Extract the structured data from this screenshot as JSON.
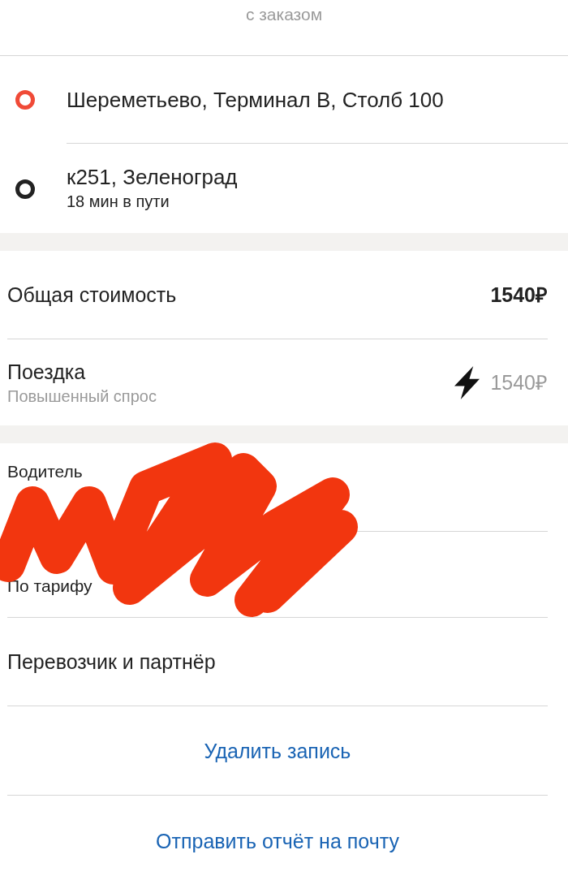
{
  "header": {
    "subtitle": "с заказом"
  },
  "route": {
    "points": [
      {
        "address": "Шереметьево, Терминал В, Столб 100",
        "color": "#f04a37"
      },
      {
        "address": "к251, Зеленоград",
        "eta": "18 мин в пути",
        "color": "#222222"
      }
    ]
  },
  "price": {
    "total": {
      "label": "Общая стоимость",
      "amount": "1540₽"
    },
    "trip": {
      "label": "Поездка",
      "note": "Повышенный спрос",
      "surge": true,
      "amount": "1540₽"
    }
  },
  "driver": {
    "redacted": true,
    "label": "Водитель",
    "tariff": "По тарифу"
  },
  "carrier": {
    "label": "Перевозчик и партнёр"
  },
  "actions": [
    {
      "label": "Удалить запись"
    },
    {
      "label": "Отправить отчёт на почту"
    }
  ]
}
